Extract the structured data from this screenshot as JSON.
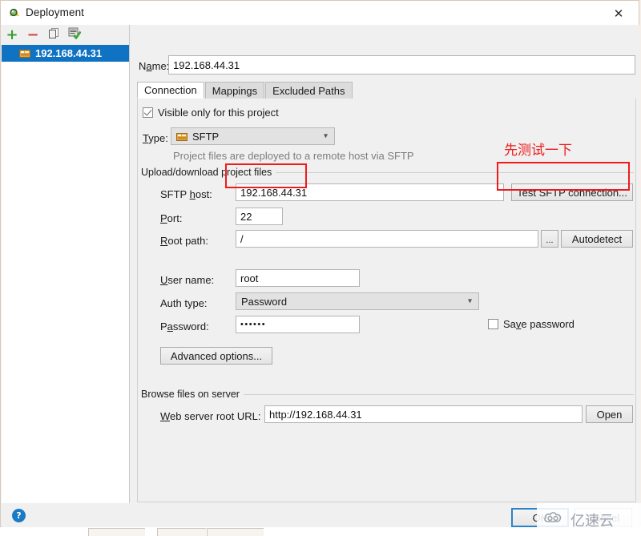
{
  "window": {
    "title": "Deployment",
    "title_icon": "deployment-icon",
    "close_label": "✕"
  },
  "sidebar": {
    "toolbar": [
      {
        "name": "add-server-button",
        "glyph": "+"
      },
      {
        "name": "remove-server-button",
        "glyph": "−"
      },
      {
        "name": "copy-server-button",
        "glyph": "copy-icon"
      },
      {
        "name": "validate-server-button",
        "glyph": "validate-icon"
      }
    ],
    "items": [
      {
        "label": "192.168.44.31",
        "icon": "server-icon",
        "selected": true
      }
    ]
  },
  "form": {
    "name_label": "Name:",
    "name_value": "192.168.44.31"
  },
  "tabs": [
    {
      "label": "Connection",
      "active": true
    },
    {
      "label": "Mappings",
      "active": false
    },
    {
      "label": "Excluded Paths",
      "active": false
    }
  ],
  "connection": {
    "visible_only_label": "Visible only for this project",
    "visible_only_checked": true,
    "type_label": "Type:",
    "type_value": "SFTP",
    "type_icon": "sftp-icon",
    "type_hint": "Project files are deployed to a remote host via SFTP",
    "upload_group_title": "Upload/download project files",
    "sftp_host_label": "SFTP host:",
    "sftp_host_value": "192.168.44.31",
    "test_button_label": "Test SFTP connection...",
    "port_label": "Port:",
    "port_value": "22",
    "root_path_label": "Root path:",
    "root_path_value": "/",
    "browse_button_label": "...",
    "autodetect_button_label": "Autodetect",
    "user_name_label": "User name:",
    "user_name_value": "root",
    "auth_type_label": "Auth type:",
    "auth_type_value": "Password",
    "password_label": "Password:",
    "password_value": "••••••",
    "save_password_label": "Save password",
    "save_password_checked": false,
    "advanced_options_label": "Advanced options...",
    "browse_group_title": "Browse files on server",
    "web_url_label": "Web server root URL:",
    "web_url_value": "http://192.168.44.31",
    "open_button_label": "Open"
  },
  "annotations": [
    {
      "name": "annotation-test-first",
      "text": "先测试一下",
      "color": "#ee1c1c"
    }
  ],
  "footer": {
    "help_label": "?",
    "ok_label": "OK",
    "cancel_label": "Cancel"
  },
  "watermark": {
    "text": "亿速云",
    "logo": "cloud-logo"
  }
}
